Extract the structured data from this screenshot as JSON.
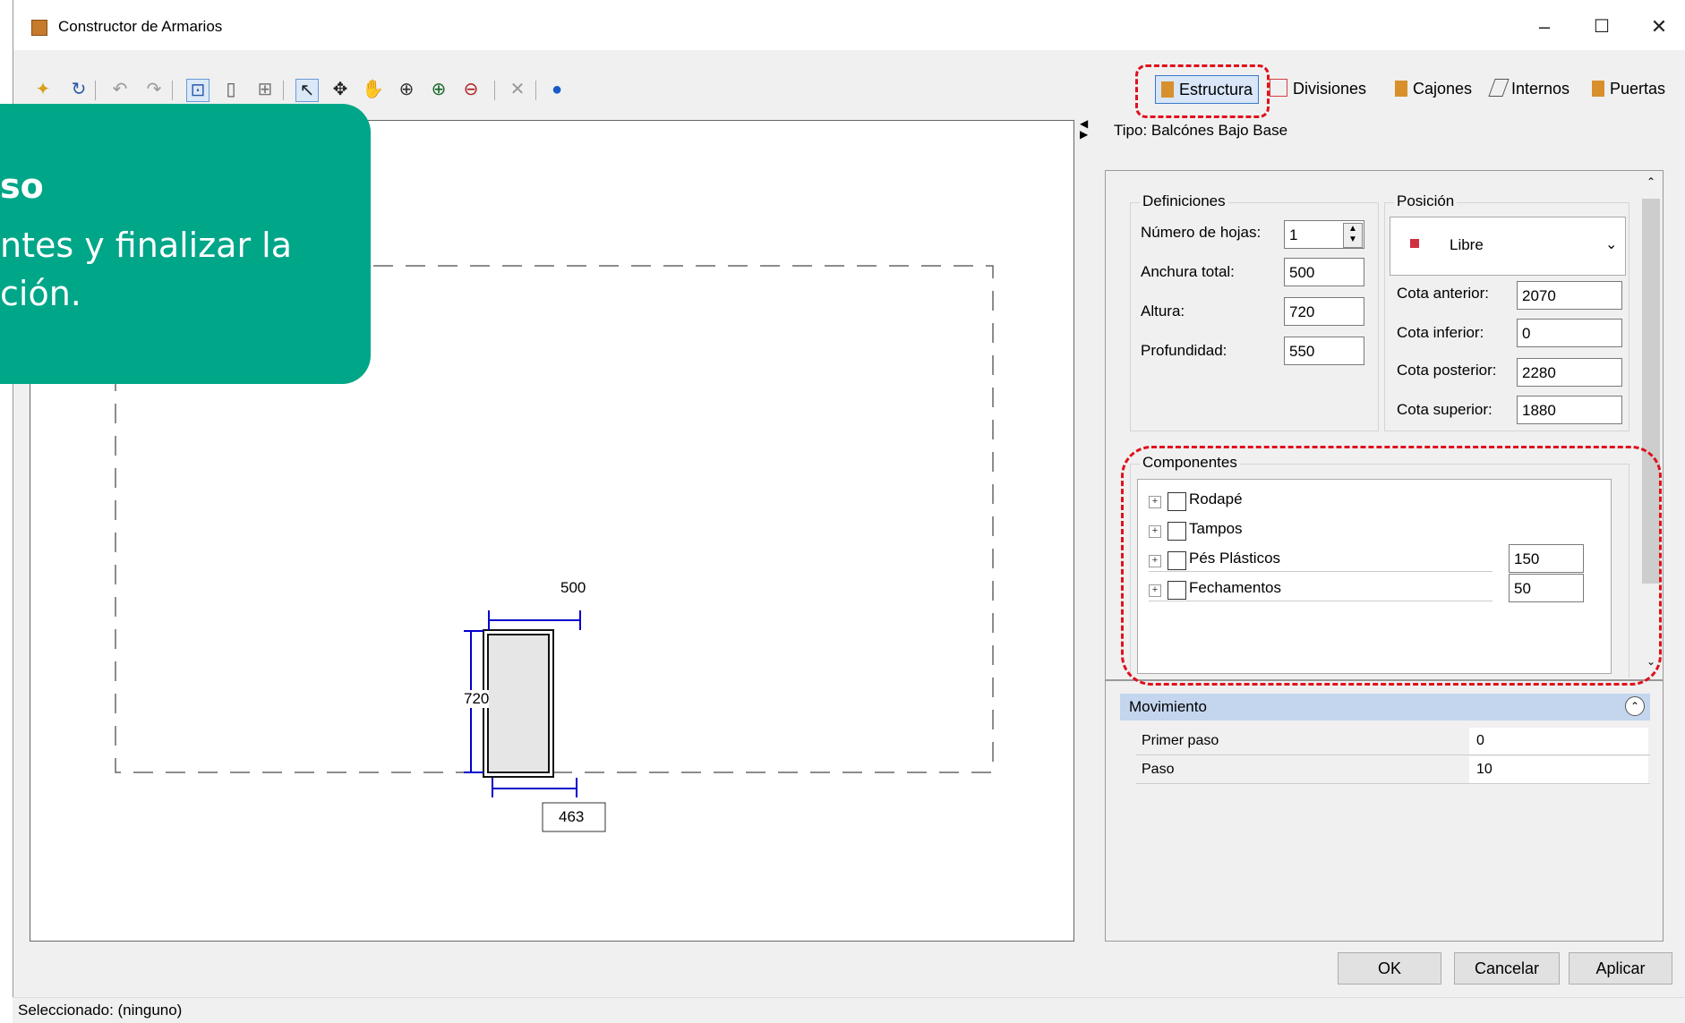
{
  "window": {
    "title": "Constructor de Armarios"
  },
  "window_controls": {
    "minimize": "–",
    "maximize": "☐",
    "close": "✕"
  },
  "tabs": [
    {
      "label": "Estructura"
    },
    {
      "label": "Divisiones"
    },
    {
      "label": "Cajones"
    },
    {
      "label": "Internos"
    },
    {
      "label": "Puertas"
    }
  ],
  "type_label": "Tipo: Balcónes Bajo Base",
  "definitions": {
    "title": "Definiciones",
    "sheets_label": "Número de hojas:",
    "sheets_value": "1",
    "width_label": "Anchura total:",
    "width_value": "500",
    "height_label": "Altura:",
    "height_value": "720",
    "depth_label": "Profundidad:",
    "depth_value": "550"
  },
  "position": {
    "title": "Posición",
    "dropdown": "Libre",
    "front_label": "Cota anterior:",
    "front_value": "2070",
    "bottom_label": "Cota inferior:",
    "bottom_value": "0",
    "back_label": "Cota posterior:",
    "back_value": "2280",
    "top_label": "Cota superior:",
    "top_value": "1880"
  },
  "components": {
    "title": "Componentes",
    "items": [
      {
        "label": "Rodapé",
        "value": ""
      },
      {
        "label": "Tampos",
        "value": ""
      },
      {
        "label": "Pés Plásticos",
        "value": "150"
      },
      {
        "label": "Fechamentos",
        "value": "50"
      }
    ]
  },
  "movement": {
    "title": "Movimiento",
    "first_step_label": "Primer paso",
    "first_step_value": "0",
    "step_label": "Paso",
    "step_value": "10"
  },
  "drawing": {
    "width_dim": "500",
    "height_dim": "720",
    "bottom_dim": "463"
  },
  "buttons": {
    "ok": "OK",
    "cancel": "Cancelar",
    "apply": "Aplicar"
  },
  "status": "Seleccionado: (ninguno)",
  "tooltip": {
    "heading": "so",
    "line1": "ntes y finalizar la",
    "line2": "ción."
  },
  "colors": {
    "accent_green": "#00a688",
    "highlight_red": "#e0101c",
    "dimension_blue": "#0000cc"
  }
}
